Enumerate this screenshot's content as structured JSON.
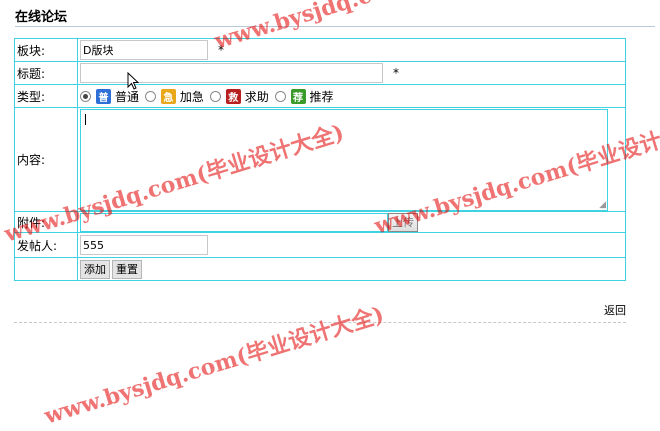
{
  "header": {
    "title": "在线论坛"
  },
  "form": {
    "board": {
      "label": "板块:",
      "value": "D版块",
      "required_mark": "*"
    },
    "subject": {
      "label": "标题:",
      "value": "",
      "required_mark": "*"
    },
    "type": {
      "label": "类型:",
      "selected": "普通",
      "options": [
        {
          "label": "普通",
          "icon_char": "普",
          "icon": "normal-icon",
          "color": "#2d6fd6"
        },
        {
          "label": "加急",
          "icon_char": "急",
          "icon": "urgent-icon",
          "color": "#e9a81a"
        },
        {
          "label": "求助",
          "icon_char": "救",
          "icon": "help-icon",
          "color": "#b82020"
        },
        {
          "label": "推荐",
          "icon_char": "荐",
          "icon": "recommend-icon",
          "color": "#3a9a2a"
        }
      ]
    },
    "content": {
      "label": "内容:",
      "value": ""
    },
    "attachment": {
      "label": "附件:",
      "value": "",
      "upload_label": "上传"
    },
    "poster": {
      "label": "发帖人:",
      "value": "555"
    },
    "buttons": {
      "add": "添加",
      "reset": "重置"
    }
  },
  "footer": {
    "back_label": "返回"
  },
  "watermark": {
    "text": "www.bysjdq.com(毕业设计大全)"
  }
}
